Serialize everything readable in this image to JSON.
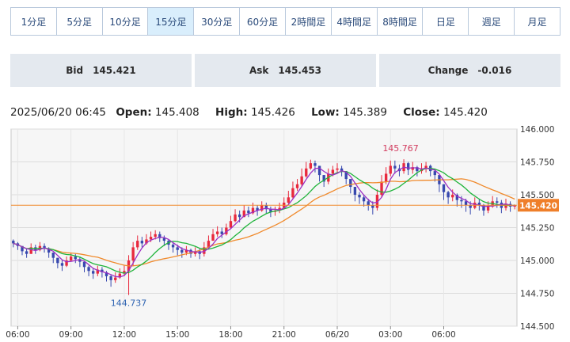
{
  "tabs": [
    {
      "label": "1分足",
      "active": false
    },
    {
      "label": "5分足",
      "active": false
    },
    {
      "label": "10分足",
      "active": false
    },
    {
      "label": "15分足",
      "active": true
    },
    {
      "label": "30分足",
      "active": false
    },
    {
      "label": "60分足",
      "active": false
    },
    {
      "label": "2時間足",
      "active": false
    },
    {
      "label": "4時間足",
      "active": false
    },
    {
      "label": "8時間足",
      "active": false
    },
    {
      "label": "日足",
      "active": false
    },
    {
      "label": "週足",
      "active": false
    },
    {
      "label": "月足",
      "active": false
    }
  ],
  "quotes": {
    "bid_label": "Bid",
    "bid_value": "145.421",
    "ask_label": "Ask",
    "ask_value": "145.453",
    "change_label": "Change",
    "change_value": "-0.016"
  },
  "ohlc": {
    "datetime": "2025/06/20 06:45",
    "open_label": "Open:",
    "open": "145.408",
    "high_label": "High:",
    "high": "145.426",
    "low_label": "Low:",
    "low": "145.389",
    "close_label": "Close:",
    "close": "145.420"
  },
  "chart_data": {
    "type": "candlestick",
    "ylim": [
      144.5,
      146.0
    ],
    "y_ticks": [
      "146.000",
      "145.750",
      "145.500",
      "145.250",
      "145.000",
      "144.750",
      "144.500"
    ],
    "x_ticks": [
      "06:00",
      "09:00",
      "12:00",
      "15:00",
      "18:00",
      "21:00",
      "06/20",
      "03:00",
      "06:00"
    ],
    "grid": true,
    "current_price": 145.42,
    "current_price_label": "145.420",
    "annotations": [
      {
        "text": "145.767",
        "kind": "high"
      },
      {
        "text": "144.737",
        "kind": "low"
      }
    ],
    "colors": {
      "up": "#e8293d",
      "down": "#3748ae",
      "ma_short": "#9c2fc4",
      "ma_mid": "#20b43b",
      "ma_long": "#f08a2c",
      "price_line": "#f08a2c",
      "price_tag": "#ef7f2a"
    },
    "closes": [
      145.13,
      145.11,
      145.07,
      145.05,
      145.1,
      145.08,
      145.11,
      145.09,
      145.06,
      145.02,
      144.98,
      144.96,
      145.0,
      145.03,
      145.01,
      144.99,
      144.95,
      144.92,
      144.9,
      144.93,
      144.91,
      144.88,
      144.85,
      144.87,
      144.9,
      144.92,
      145.0,
      145.1,
      145.15,
      145.13,
      145.16,
      145.18,
      145.2,
      145.17,
      145.15,
      145.12,
      145.1,
      145.08,
      145.06,
      145.08,
      145.05,
      145.07,
      145.05,
      145.1,
      145.15,
      145.2,
      145.22,
      145.2,
      145.25,
      145.3,
      145.35,
      145.33,
      145.38,
      145.36,
      145.4,
      145.38,
      145.42,
      145.39,
      145.37,
      145.38,
      145.4,
      145.44,
      145.48,
      145.55,
      145.58,
      145.64,
      145.7,
      145.74,
      145.72,
      145.65,
      145.6,
      145.66,
      145.69,
      145.7,
      145.68,
      145.62,
      145.56,
      145.5,
      145.48,
      145.45,
      145.42,
      145.4,
      145.5,
      145.6,
      145.66,
      145.72,
      145.7,
      145.68,
      145.74,
      145.69,
      145.71,
      145.68,
      145.7,
      145.72,
      145.68,
      145.65,
      145.58,
      145.52,
      145.48,
      145.5,
      145.46,
      145.45,
      145.42,
      145.4,
      145.44,
      145.42,
      145.38,
      145.41,
      145.45,
      145.44,
      145.4,
      145.43,
      145.41,
      145.42
    ],
    "highs": [
      145.16,
      145.14,
      145.1,
      145.09,
      145.13,
      145.12,
      145.14,
      145.13,
      145.1,
      145.06,
      145.02,
      145.0,
      145.03,
      145.06,
      145.05,
      145.03,
      144.99,
      144.96,
      144.94,
      144.96,
      144.95,
      144.92,
      144.89,
      144.91,
      144.94,
      144.96,
      145.04,
      145.14,
      145.19,
      145.18,
      145.2,
      145.22,
      145.23,
      145.22,
      145.19,
      145.16,
      145.13,
      145.12,
      145.1,
      145.11,
      145.09,
      145.1,
      145.09,
      145.14,
      145.19,
      145.24,
      145.26,
      145.25,
      145.28,
      145.34,
      145.39,
      145.38,
      145.42,
      145.41,
      145.44,
      145.42,
      145.45,
      145.44,
      145.41,
      145.41,
      145.44,
      145.48,
      145.53,
      145.6,
      145.62,
      145.7,
      145.75,
      145.767,
      145.76,
      145.72,
      145.65,
      145.7,
      145.72,
      145.74,
      145.72,
      145.68,
      145.61,
      145.56,
      145.52,
      145.5,
      145.47,
      145.45,
      145.54,
      145.65,
      145.71,
      145.76,
      145.76,
      145.73,
      145.77,
      145.75,
      145.75,
      145.72,
      145.74,
      145.75,
      145.73,
      145.7,
      145.64,
      145.57,
      145.53,
      145.54,
      145.51,
      145.49,
      145.47,
      145.45,
      145.48,
      145.47,
      145.43,
      145.45,
      145.49,
      145.48,
      145.46,
      145.47,
      145.45,
      145.426
    ],
    "lows": [
      145.1,
      145.08,
      145.04,
      145.02,
      145.05,
      145.05,
      145.07,
      145.06,
      145.02,
      144.98,
      144.94,
      144.92,
      144.95,
      144.99,
      144.98,
      144.95,
      144.91,
      144.88,
      144.86,
      144.88,
      144.87,
      144.84,
      144.8,
      144.83,
      144.86,
      144.88,
      144.737,
      144.96,
      145.08,
      145.1,
      145.12,
      145.14,
      145.16,
      145.14,
      145.11,
      145.08,
      145.06,
      145.04,
      145.02,
      145.04,
      145.02,
      145.03,
      145.01,
      145.03,
      145.09,
      145.15,
      145.18,
      145.17,
      145.19,
      145.24,
      145.29,
      145.29,
      145.33,
      145.33,
      145.35,
      145.34,
      145.37,
      145.36,
      145.33,
      145.34,
      145.36,
      145.39,
      145.43,
      145.47,
      145.53,
      145.56,
      145.63,
      145.69,
      145.67,
      145.6,
      145.56,
      145.58,
      145.64,
      145.66,
      145.64,
      145.58,
      145.51,
      145.45,
      145.43,
      145.41,
      145.38,
      145.35,
      145.38,
      145.48,
      145.58,
      145.64,
      145.66,
      145.64,
      145.66,
      145.65,
      145.66,
      145.64,
      145.66,
      145.67,
      145.64,
      145.6,
      145.52,
      145.46,
      145.43,
      145.45,
      145.41,
      145.4,
      145.37,
      145.35,
      145.39,
      145.38,
      145.34,
      145.36,
      145.4,
      145.4,
      145.36,
      145.38,
      145.37,
      145.389
    ]
  }
}
